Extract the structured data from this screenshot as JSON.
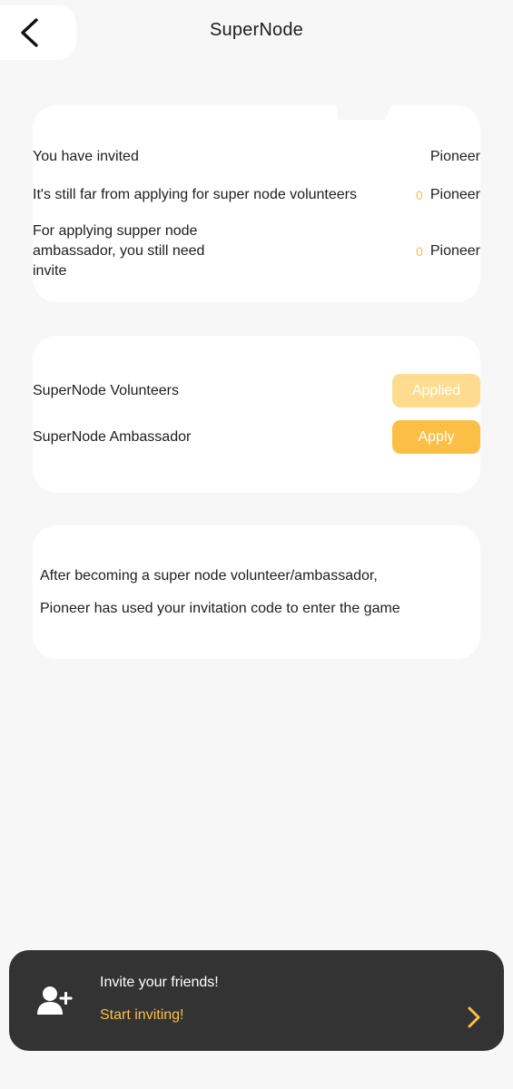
{
  "header": {
    "title": "SuperNode",
    "back_icon": "chevron-left-icon"
  },
  "invite_status": {
    "rows": [
      {
        "label": "You have invited",
        "count": "",
        "unit": "Pioneer"
      },
      {
        "label": "It's still far from applying for super node volunteers",
        "count": "0",
        "unit": "Pioneer"
      },
      {
        "label": "For applying supper node ambassador, you still need invite",
        "count": "0",
        "unit": "Pioneer"
      }
    ]
  },
  "applications": {
    "rows": [
      {
        "label": "SuperNode Volunteers",
        "button": "Applied",
        "state": "applied"
      },
      {
        "label": "SuperNode Ambassador",
        "button": "Apply",
        "state": "available"
      }
    ]
  },
  "description": {
    "lines": [
      "After becoming a super node volunteer/ambassador,",
      "Pioneer has used your invitation code to enter the game"
    ]
  },
  "invite_banner": {
    "title": "Invite your friends!",
    "link": "Start inviting!",
    "icon": "add-user-icon",
    "chevron": "chevron-right-icon"
  },
  "colors": {
    "accent": "#fcbf45",
    "accent_light": "#fddc8f",
    "banner_bg": "#333333",
    "page_bg": "#f7f7f7"
  }
}
